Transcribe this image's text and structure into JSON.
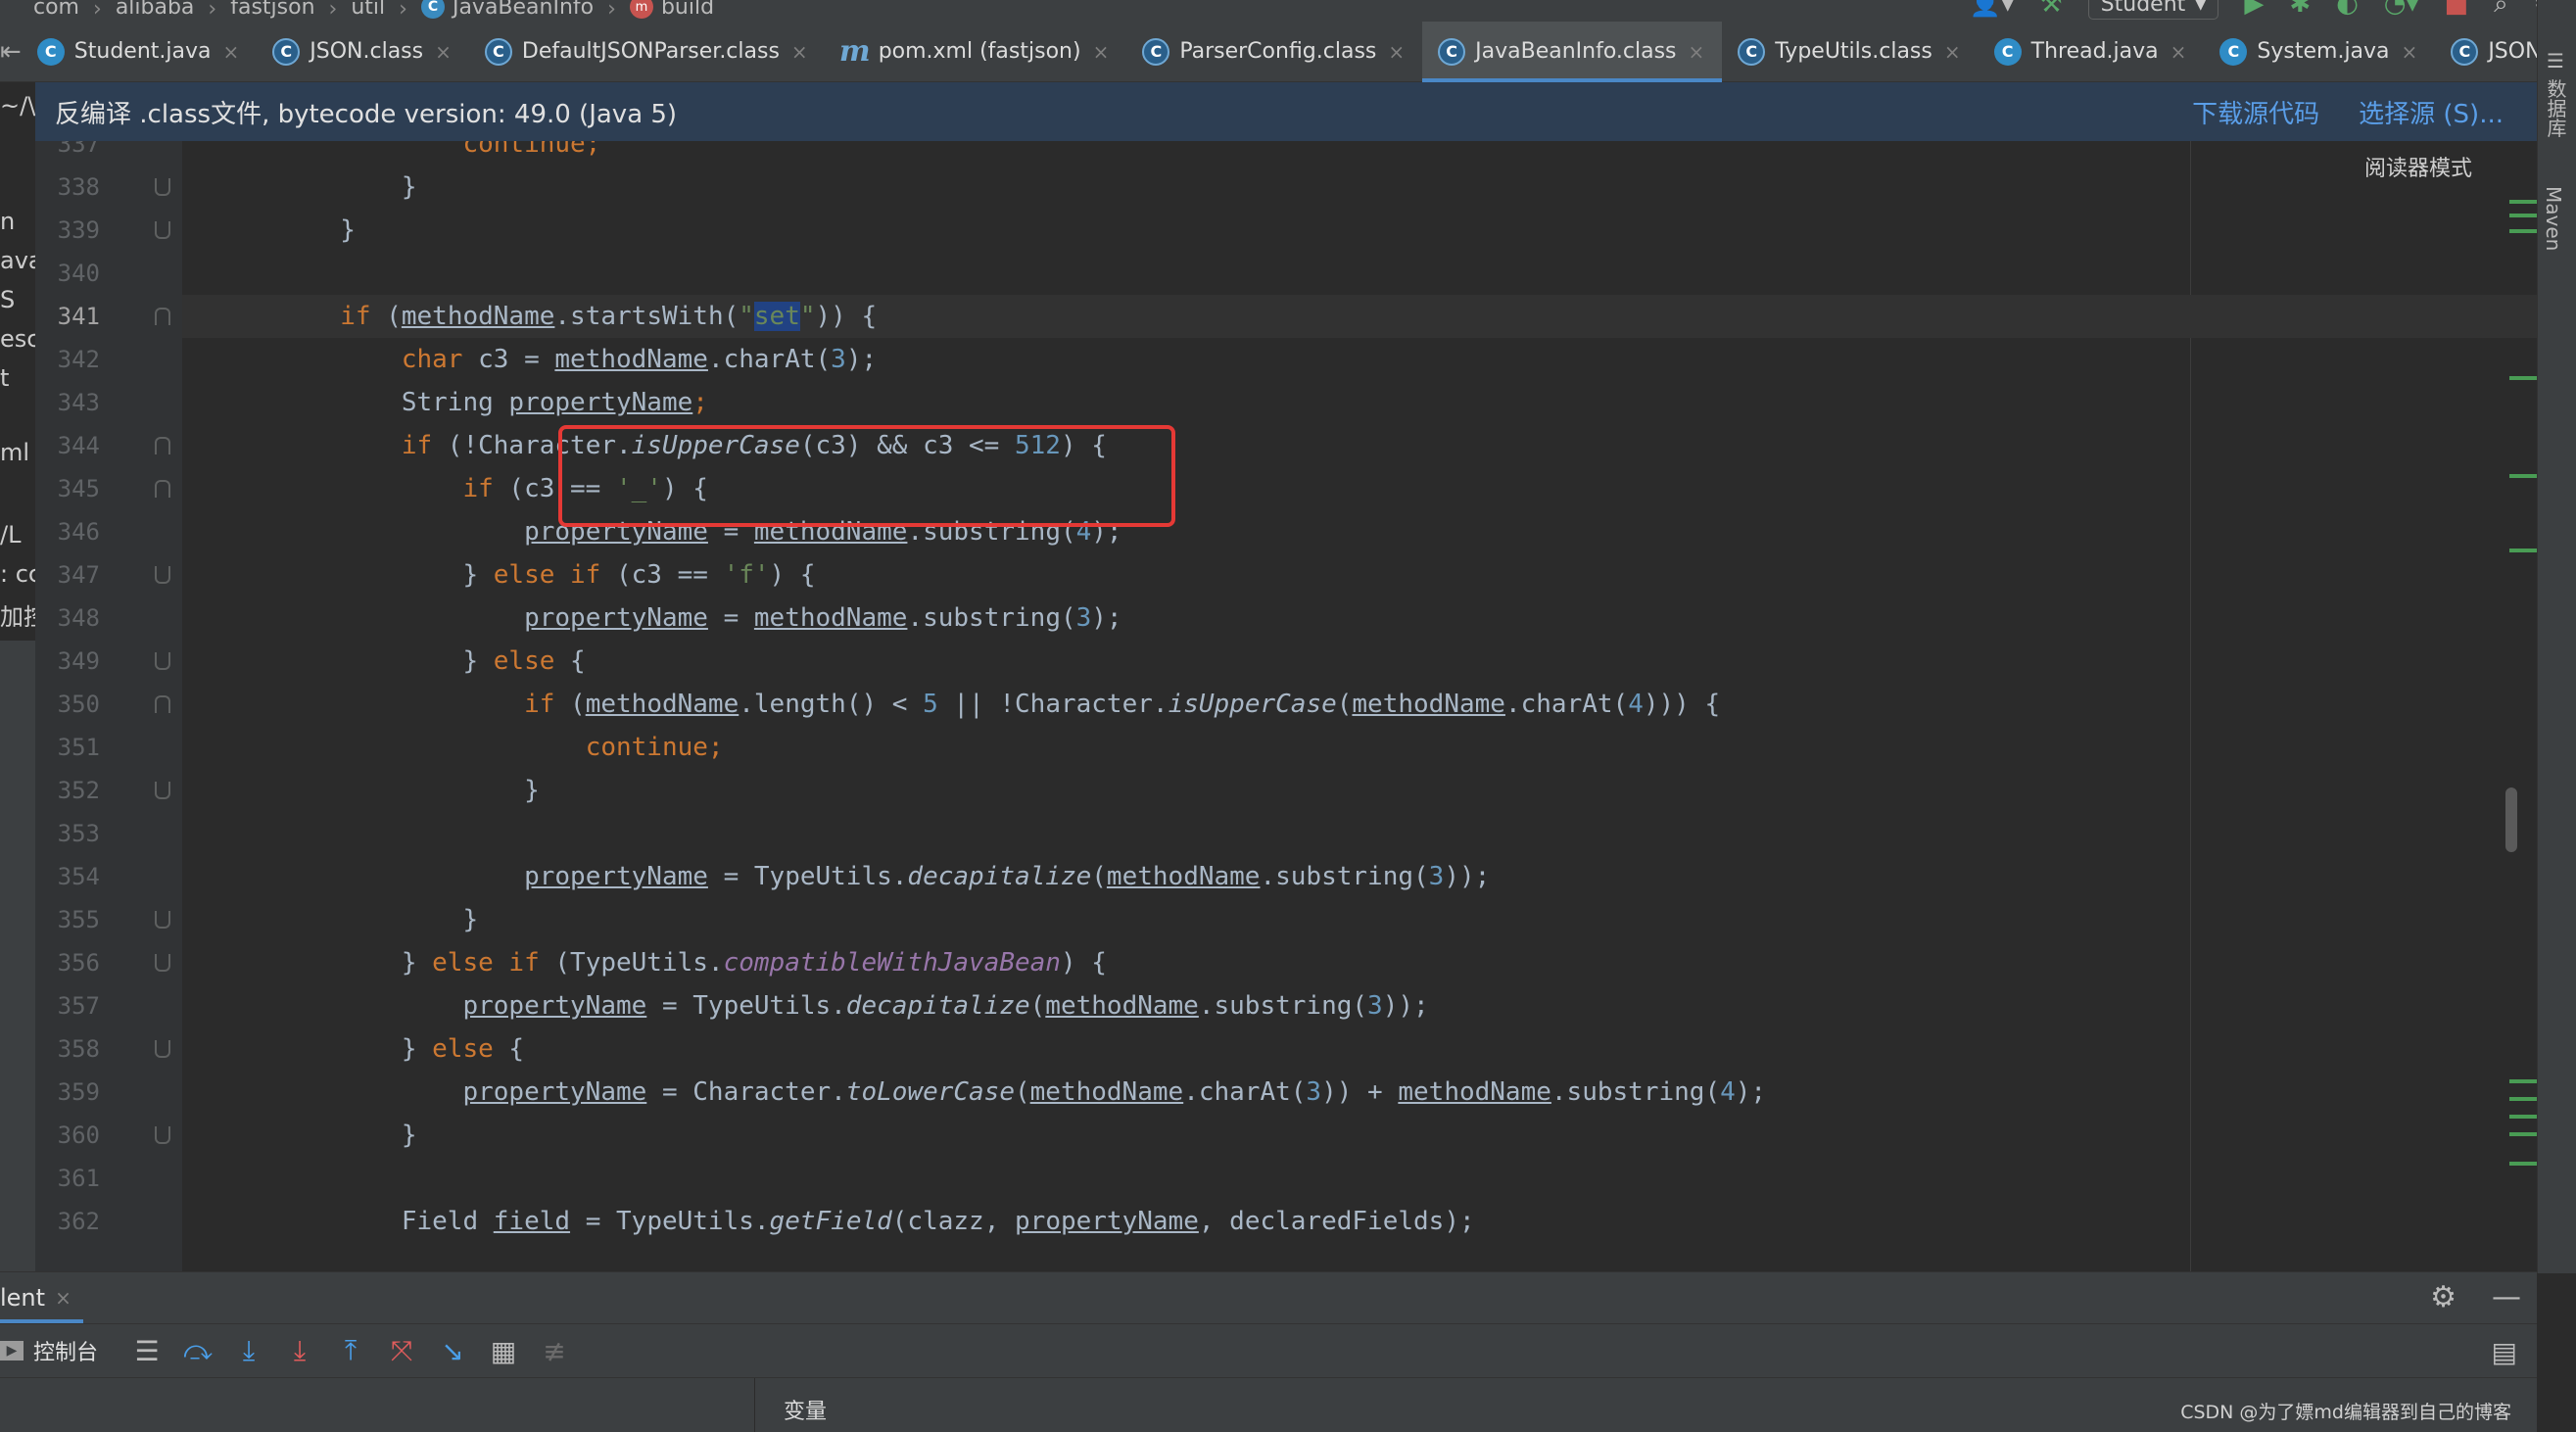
{
  "breadcrumb": {
    "items": [
      "com",
      "alibaba",
      "fastjson",
      "util",
      "JavaBeanInfo",
      "build"
    ]
  },
  "toolbar": {
    "run_config": "Student"
  },
  "tabs": [
    {
      "label": "Student.java",
      "icon": "java-class-icon",
      "active": false
    },
    {
      "label": "JSON.class",
      "icon": "compiled-class-icon",
      "active": false
    },
    {
      "label": "DefaultJSONParser.class",
      "icon": "compiled-class-icon",
      "active": false
    },
    {
      "label": "pom.xml (fastjson)",
      "icon": "maven-icon",
      "active": false
    },
    {
      "label": "ParserConfig.class",
      "icon": "compiled-class-icon",
      "active": false
    },
    {
      "label": "JavaBeanInfo.class",
      "icon": "compiled-class-icon",
      "active": true
    },
    {
      "label": "TypeUtils.class",
      "icon": "compiled-class-icon",
      "active": false
    },
    {
      "label": "Thread.java",
      "icon": "java-class-icon",
      "active": false
    },
    {
      "label": "System.java",
      "icon": "java-class-icon",
      "active": false
    },
    {
      "label": "JSONLe",
      "icon": "compiled-class-icon",
      "active": false
    }
  ],
  "banner": {
    "text": "反编译 .class文件, bytecode version: 49.0 (Java 5)",
    "download_source": "下载源代码",
    "choose_source": "选择源 (S)..."
  },
  "editor": {
    "reader_mode": "阅读器模式",
    "current_line": 341,
    "line_numbers": [
      337,
      338,
      339,
      340,
      341,
      342,
      343,
      344,
      345,
      346,
      347,
      348,
      349,
      350,
      351,
      352,
      353,
      354,
      355,
      356,
      357,
      358,
      359,
      360,
      361,
      362
    ]
  },
  "right_stripe": {
    "database": "数据库",
    "maven": "Maven"
  },
  "left_fragments": [
    "~/\\",
    "n",
    "ava",
    "S",
    "esc",
    "t",
    "ml",
    "/L",
    ": cc",
    "加控"
  ],
  "bottom_panel": {
    "tab_label": "lent",
    "console_label": "控制台",
    "variables_label": "变量"
  },
  "watermark": "CSDN @为了嫖md编辑器到自己的博客",
  "colors": {
    "keyword": "#cc7832",
    "string": "#6a8759",
    "number": "#6897bb",
    "highlight_box": "#e53935",
    "accent": "#4a88c7"
  }
}
